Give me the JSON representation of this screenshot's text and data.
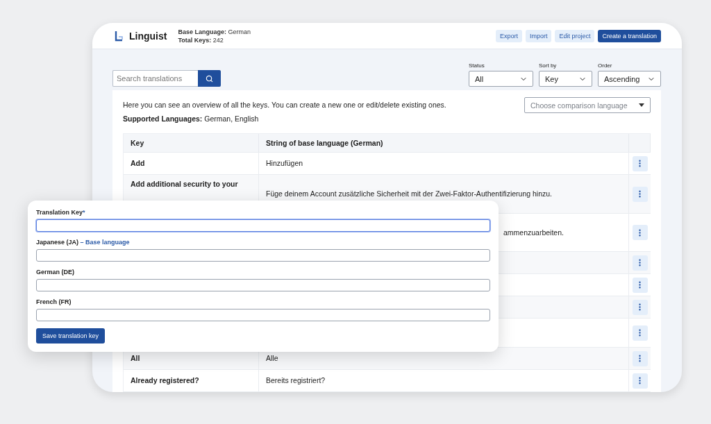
{
  "app": {
    "name": "Linguist",
    "meta": [
      {
        "label": "Base Language:",
        "value": "German"
      },
      {
        "label": "Total Keys:",
        "value": "242"
      }
    ],
    "actions": [
      {
        "label": "Export",
        "primary": false
      },
      {
        "label": "Import",
        "primary": false
      },
      {
        "label": "Edit project",
        "primary": false
      },
      {
        "label": "Create a translation",
        "primary": true
      }
    ]
  },
  "search": {
    "placeholder": "Search translations"
  },
  "filters": [
    {
      "label": "Status",
      "value": "All"
    },
    {
      "label": "Sort by",
      "value": "Key"
    },
    {
      "label": "Order",
      "value": "Ascending"
    }
  ],
  "overview": {
    "intro": "Here you can see an overview of all the keys. You can create a new one or edit/delete existing ones.",
    "supported": "**Supported Languages:** German, English",
    "comparison": {
      "placeholder": "Choose comparison language"
    }
  },
  "table": {
    "columns": [
      "Key",
      "String of base language (German)"
    ],
    "rows": [
      {
        "key": "Add",
        "value": "Hinzufügen"
      },
      {
        "key": "Add additional security to your",
        "value": "Füge deinem Account zusätzliche Sicherheit mit der Zwei-Faktor-Authentifizierung hinzu."
      },
      {
        "value": "ammenzuarbeiten.",
        "cut_start": true
      },
      {},
      {},
      {},
      {},
      {
        "key": "All",
        "value": "Alle"
      },
      {
        "key": "Already registered?",
        "value": "Bereits registriert?"
      }
    ]
  },
  "form": {
    "fields": [
      {
        "label": "Translation Key",
        "mark": "*",
        "focused": true
      },
      {
        "label": "Japanese (JA)",
        "note": "– Base language",
        "focused": false
      },
      {
        "label": "German (DE)",
        "focused": false
      },
      {
        "label": "French (FR)",
        "focused": false
      }
    ],
    "submit": "Save translation key"
  }
}
